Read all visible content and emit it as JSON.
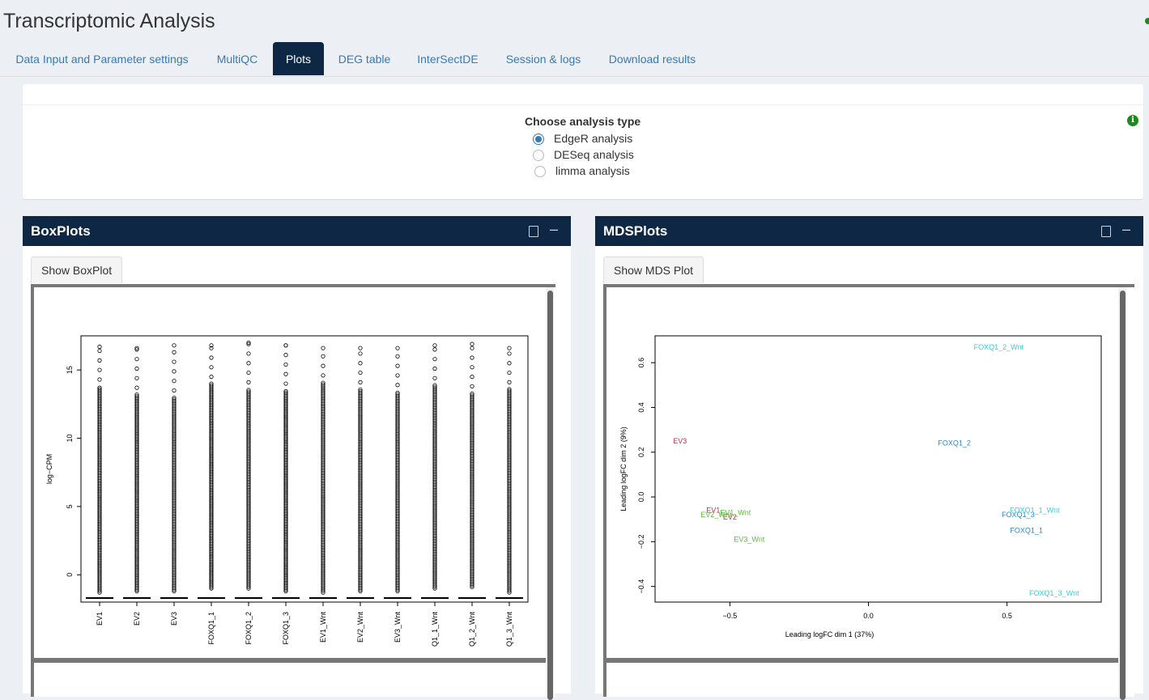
{
  "app": {
    "title": "Transcriptomic Analysis"
  },
  "tabs": [
    {
      "label": "Data Input and Parameter settings"
    },
    {
      "label": "MultiQC"
    },
    {
      "label": "Plots"
    },
    {
      "label": "DEG table"
    },
    {
      "label": "InterSectDE"
    },
    {
      "label": "Session & logs"
    },
    {
      "label": "Download results"
    }
  ],
  "analysis": {
    "title": "Choose analysis type",
    "options": [
      "EdgeR analysis",
      "DESeq analysis",
      "limma analysis"
    ],
    "selected": "EdgeR analysis"
  },
  "boxplot_panel": {
    "title": "BoxPlots",
    "button": "Show BoxPlot"
  },
  "mds_panel": {
    "title": "MDSPlots",
    "button": "Show MDS Plot"
  },
  "chart_data": [
    {
      "type": "box",
      "ylabel": "log−CPM",
      "xlabel": "",
      "categories": [
        "EV1",
        "EV2",
        "EV3",
        "FOXQ1_1",
        "FOXQ1_2",
        "FOXQ1_3",
        "EV1_Wnt",
        "EV2_Wnt",
        "EV3_Wnt",
        "Q1_1_Wnt",
        "Q1_2_Wnt",
        "Q1_3_Wnt"
      ],
      "ylim": [
        -2,
        17.5
      ],
      "yticks": [
        0,
        5,
        10,
        15
      ],
      "median": -1.7,
      "whisker_top": [
        13.8,
        13.2,
        13.0,
        14.0,
        13.6,
        13.5,
        14.1,
        13.6,
        13.4,
        13.9,
        13.3,
        13.6
      ],
      "max": [
        16.7,
        16.6,
        16.8,
        16.8,
        17.0,
        16.8,
        16.6,
        16.6,
        16.6,
        16.8,
        16.9,
        16.6
      ],
      "min": [
        -1.3,
        -1.2,
        -1.2,
        -1.0,
        -1.0,
        -1.2,
        -1.3,
        -1.2,
        -1.2,
        -1.0,
        -0.9,
        -1.3
      ]
    },
    {
      "type": "scatter",
      "xlabel": "Leading logFC dim 1 (37%)",
      "ylabel": "Leading logFC dim 2 (9%)",
      "xlim": [
        -0.77,
        0.84
      ],
      "ylim": [
        -0.47,
        0.72
      ],
      "xticks": [
        -0.5,
        0.0,
        0.5
      ],
      "yticks": [
        -0.4,
        -0.2,
        0.0,
        0.2,
        0.4,
        0.6
      ],
      "points": [
        {
          "label": "EV3",
          "x": -0.68,
          "y": 0.25,
          "color": "#c0304a"
        },
        {
          "label": "EV1",
          "x": -0.56,
          "y": -0.06,
          "color": "#c0304a"
        },
        {
          "label": "EV2",
          "x": -0.5,
          "y": -0.09,
          "color": "#c0304a"
        },
        {
          "label": "EV2_Wnt",
          "x": -0.55,
          "y": -0.08,
          "color": "#5cb83c"
        },
        {
          "label": "EV1_Wnt",
          "x": -0.48,
          "y": -0.07,
          "color": "#5cb83c"
        },
        {
          "label": "EV3_Wnt",
          "x": -0.43,
          "y": -0.19,
          "color": "#5cb83c"
        },
        {
          "label": "FOXQ1_2",
          "x": 0.31,
          "y": 0.24,
          "color": "#2f86c8"
        },
        {
          "label": "FOXQ1_3",
          "x": 0.54,
          "y": -0.08,
          "color": "#2f86c8"
        },
        {
          "label": "FOXQ1_1",
          "x": 0.57,
          "y": -0.15,
          "color": "#2f86c8"
        },
        {
          "label": "FOXQ1_2_Wnt",
          "x": 0.47,
          "y": 0.67,
          "color": "#27d3e0"
        },
        {
          "label": "FOXQ1_1_Wnt",
          "x": 0.6,
          "y": -0.06,
          "color": "#27d3e0"
        },
        {
          "label": "FOXQ1_3_Wnt",
          "x": 0.67,
          "y": -0.43,
          "color": "#27d3e0"
        }
      ]
    }
  ]
}
